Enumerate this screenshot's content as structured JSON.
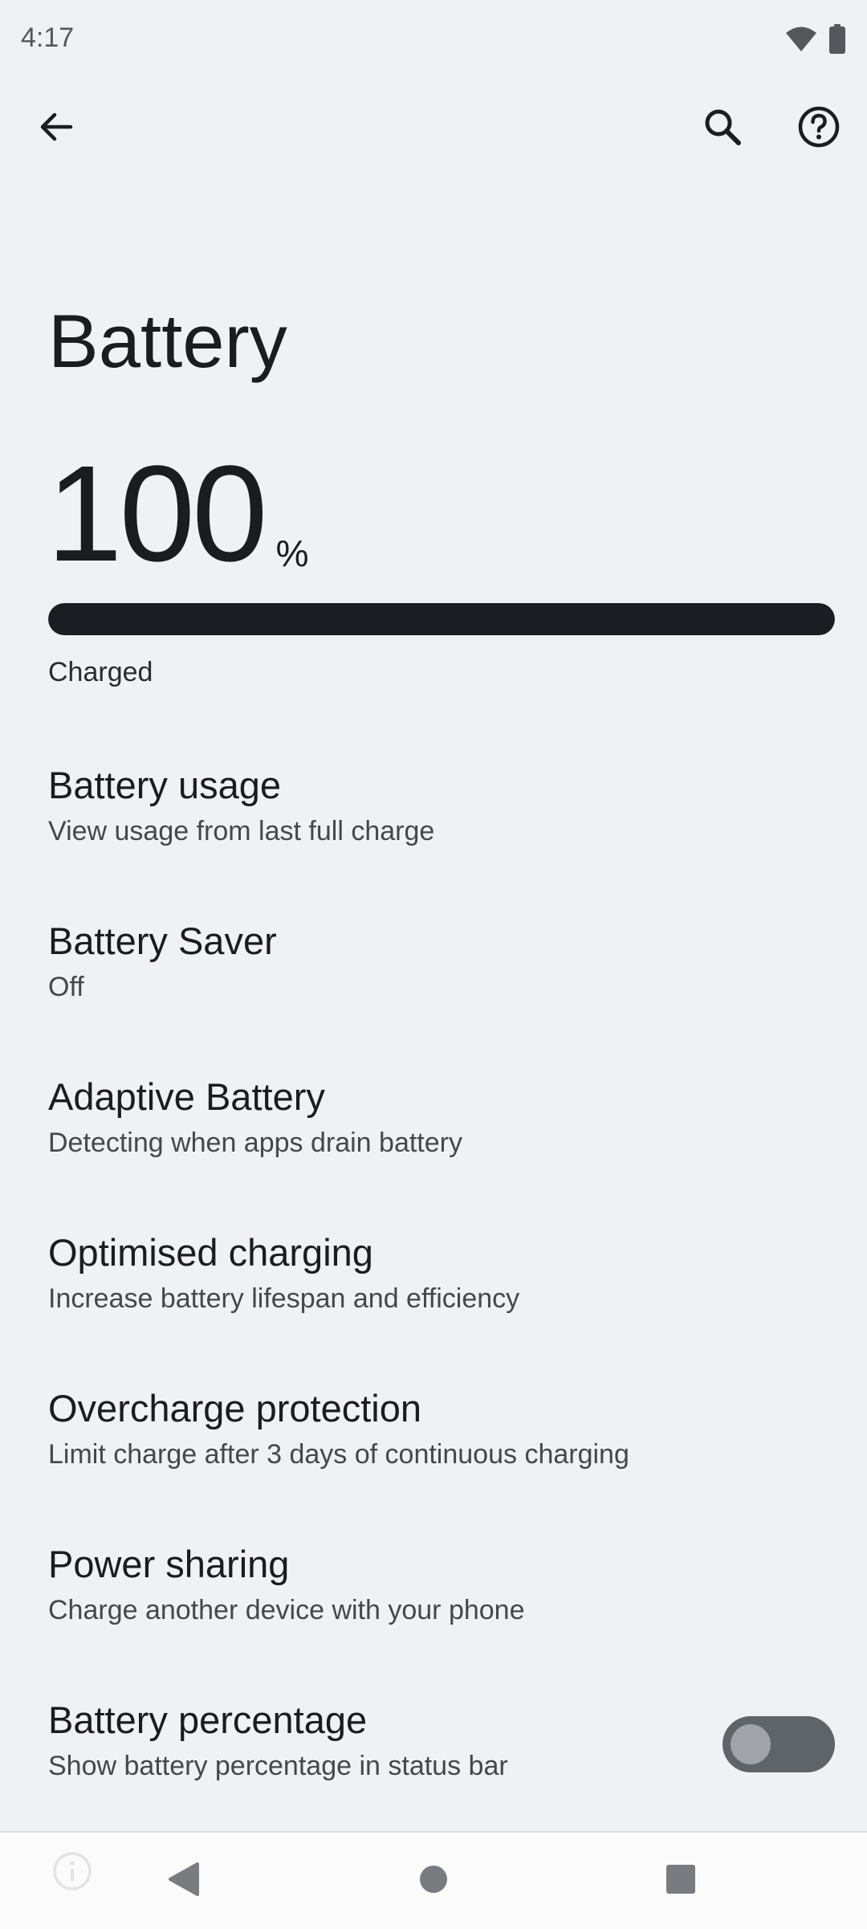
{
  "status_bar": {
    "time": "4:17",
    "icons": [
      "wifi-icon",
      "battery-icon"
    ]
  },
  "app_bar": {
    "back_icon": "arrow-left-icon",
    "search_icon": "search-icon",
    "help_icon": "help-circle-icon"
  },
  "page": {
    "title": "Battery",
    "level_value": "100",
    "level_unit": "%",
    "level_fraction": 1.0,
    "status": "Charged"
  },
  "settings": [
    {
      "title": "Battery usage",
      "summary": "View usage from last full charge"
    },
    {
      "title": "Battery Saver",
      "summary": "Off"
    },
    {
      "title": "Adaptive Battery",
      "summary": "Detecting when apps drain battery"
    },
    {
      "title": "Optimised charging",
      "summary": "Increase battery lifespan and efficiency"
    },
    {
      "title": "Overcharge protection",
      "summary": "Limit charge after 3 days of continuous charging"
    },
    {
      "title": "Power sharing",
      "summary": "Charge another device with your phone"
    },
    {
      "title": "Battery percentage",
      "summary": "Show battery percentage in status bar",
      "toggle_on": false
    }
  ],
  "nav_bar": {
    "icons": [
      "info-icon",
      "nav-back-icon",
      "nav-home-icon",
      "nav-recents-icon"
    ]
  },
  "colors": {
    "background": "#f0f1f4",
    "progress_fill": "#1b1d23",
    "toggle_track_off": "#5f6468",
    "toggle_thumb_off": "#a1a3ab"
  }
}
